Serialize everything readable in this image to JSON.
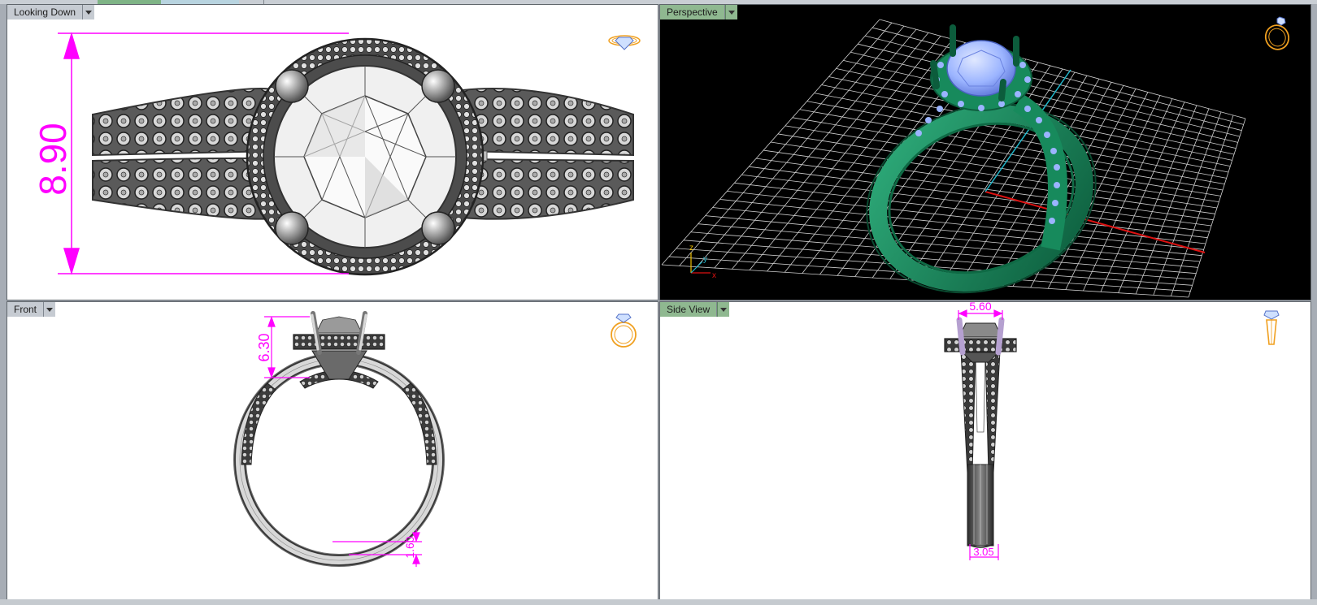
{
  "viewports": {
    "top_left": {
      "label": "Looking Down",
      "dimension": "8.90"
    },
    "top_right": {
      "label": "Perspective",
      "axes": {
        "z": "z",
        "y": "y",
        "x": "x"
      }
    },
    "bottom_left": {
      "label": "Front",
      "dimension_head": "6.30",
      "dimension_band": "1.60"
    },
    "bottom_right": {
      "label": "Side View",
      "dimension_top": "5.60",
      "dimension_bottom": "3.05"
    }
  },
  "icons": {
    "top_left": "ring-top-view-icon",
    "top_right": "ring-perspective-icon",
    "bottom_left": "ring-front-view-icon",
    "bottom_right": "ring-side-view-icon"
  },
  "colors": {
    "dimension": "#ff00ff",
    "ring_green": "#16825a",
    "gem_blue": "#9bb4ff",
    "icon_orange": "#f0a020",
    "active_label": "#8fb890",
    "axis_red": "#dd1111",
    "axis_cyan": "#22b8cc"
  }
}
